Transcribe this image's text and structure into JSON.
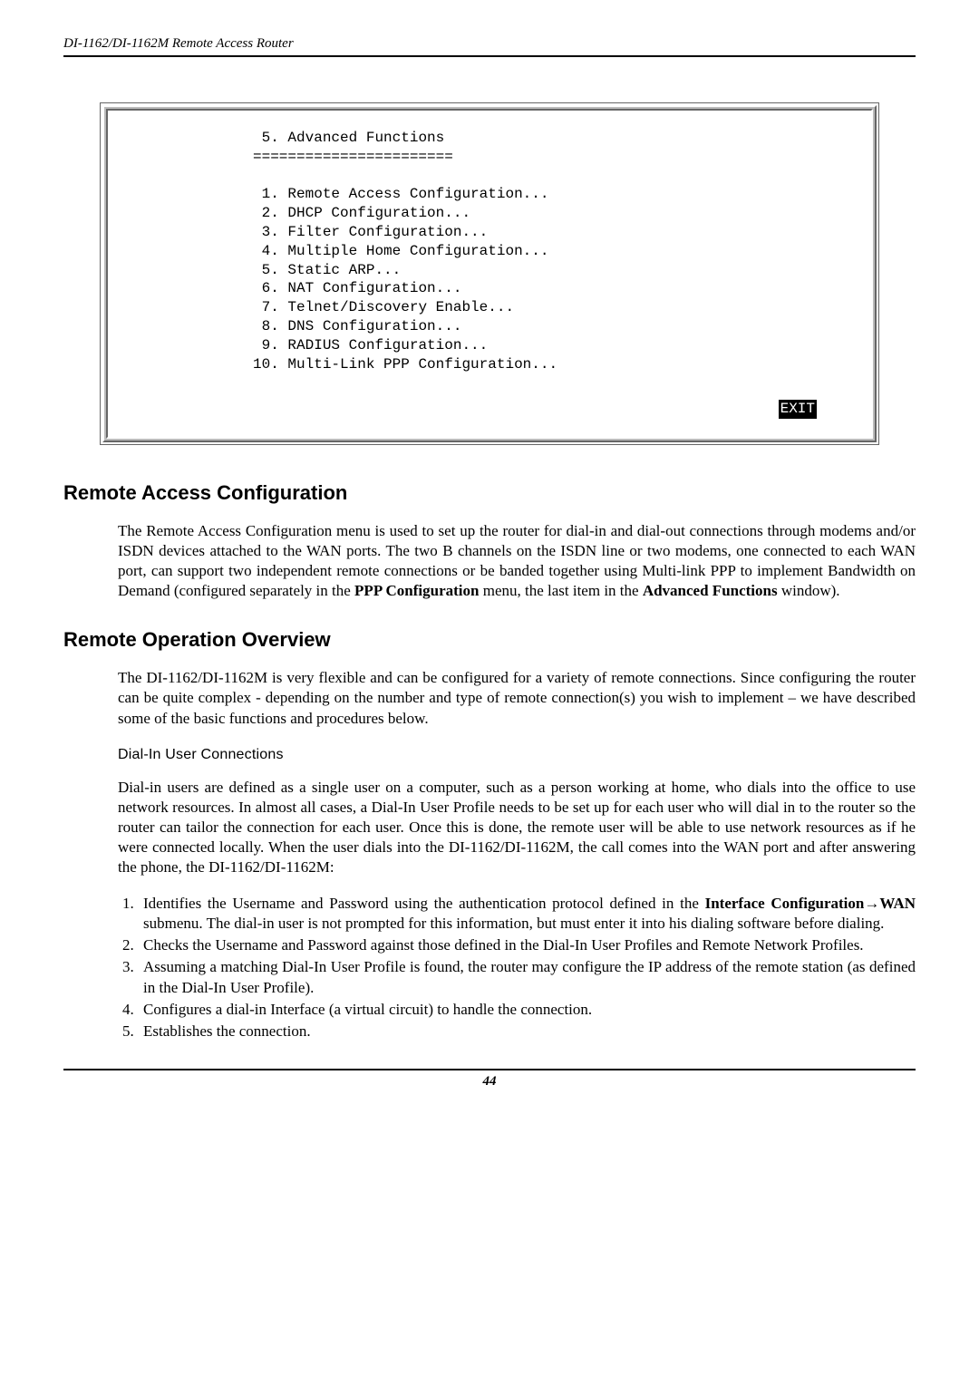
{
  "header": {
    "doc_title": "DI-1162/DI-1162M Remote Access Router"
  },
  "terminal": {
    "title_num": " 5.",
    "title": "Advanced Functions",
    "divider": "=======================",
    "items": [
      {
        "num": " 1.",
        "label": "Remote Access Configuration..."
      },
      {
        "num": " 2.",
        "label": "DHCP Configuration..."
      },
      {
        "num": " 3.",
        "label": "Filter Configuration..."
      },
      {
        "num": " 4.",
        "label": "Multiple Home Configuration..."
      },
      {
        "num": " 5.",
        "label": "Static ARP..."
      },
      {
        "num": " 6.",
        "label": "NAT Configuration..."
      },
      {
        "num": " 7.",
        "label": "Telnet/Discovery Enable..."
      },
      {
        "num": " 8.",
        "label": "DNS Configuration..."
      },
      {
        "num": " 9.",
        "label": "RADIUS Configuration..."
      },
      {
        "num": "10.",
        "label": "Multi-Link PPP Configuration..."
      }
    ],
    "exit": "EXIT"
  },
  "section1": {
    "heading": "Remote Access Configuration",
    "para_pre": "The Remote Access Configuration menu is used to set up the router for dial-in and dial-out connections through modems and/or ISDN devices attached to the WAN ports. The two B channels on the ISDN line or two modems, one connected to each WAN port, can support two independent remote connections or be banded together using Multi-link PPP to implement Bandwidth on Demand (configured separately in the ",
    "bold1": "PPP Configuration",
    "para_mid": " menu, the last item in the ",
    "bold2": "Advanced Functions",
    "para_post": " window)."
  },
  "section2": {
    "heading": "Remote Operation Overview",
    "para": "The DI-1162/DI-1162M is very flexible and can be configured for a variety of remote connections. Since configuring the router can be quite complex - depending on the number and type of remote connection(s) you wish to implement – we have described some of the basic functions and procedures below."
  },
  "dialin": {
    "subhead": "Dial-In User Connections",
    "para": "Dial-in users are defined as a single user on a computer, such as a person working at home, who dials into the office to use network resources. In almost all cases, a Dial-In User Profile needs to be set up for each user who will dial in to the router so the router can tailor the connection for each user. Once this is done, the remote user will be able to use network resources as if he were connected locally. When the user dials into the DI-1162/DI-1162M, the call comes into the WAN port and after answering the phone, the DI-1162/DI-1162M:",
    "steps": {
      "s1_pre": "Identifies the Username and Password using the authentication protocol defined in the ",
      "s1_bold1": "Interface Configuration",
      "s1_arrow": "→",
      "s1_bold2": "WAN",
      "s1_post": " submenu. The dial-in user is not prompted for this information, but must enter it into his dialing software before dialing.",
      "s2": "Checks the Username and Password against those defined in the Dial-In User Profiles and Remote Network Profiles.",
      "s3": "Assuming a matching Dial-In User Profile is found, the router may configure the IP address of the remote station (as defined in the Dial-In User Profile).",
      "s4": "Configures a dial-in Interface (a virtual circuit) to handle the connection.",
      "s5": "Establishes the connection."
    }
  },
  "footer": {
    "page": "44"
  }
}
